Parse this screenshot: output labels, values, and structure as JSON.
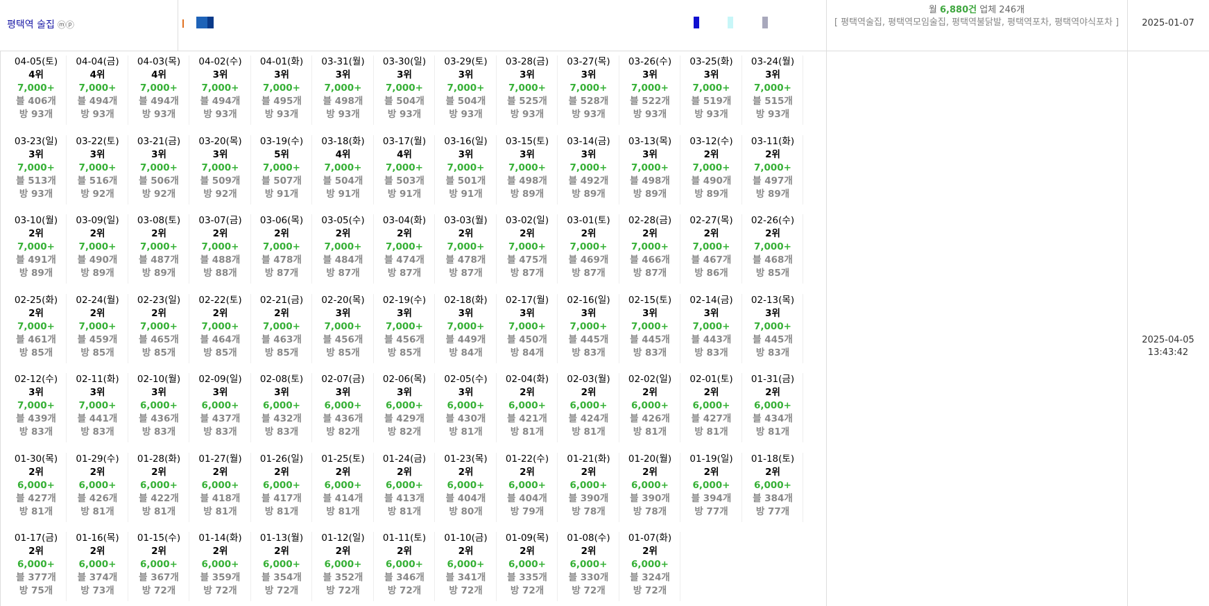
{
  "header": {
    "keyword": "평택역 술집",
    "keyword_symbols": "ⓜⓟ",
    "summary_prefix": "월",
    "monthly_count": "6,880건",
    "business_count": "업체 246개",
    "related_keywords": "[ 평택역술집, 평택역모임술집, 평택역불닭발, 평택역포차, 평택역야식포차 ]",
    "start_date": "2025-01-07"
  },
  "side": {
    "updated_date": "2025-04-05",
    "updated_time": "13:43:42"
  },
  "colors": {
    "green": "#36b036",
    "keyword_blue": "#1a1aa6",
    "gray": "#888888"
  },
  "days": [
    {
      "date": "04-05(토)",
      "rank": "4위",
      "volume": "7,000+",
      "blog": "블 406개",
      "cafe": "방 93개"
    },
    {
      "date": "04-04(금)",
      "rank": "4위",
      "volume": "7,000+",
      "blog": "블 494개",
      "cafe": "방 93개"
    },
    {
      "date": "04-03(목)",
      "rank": "4위",
      "volume": "7,000+",
      "blog": "블 494개",
      "cafe": "방 93개"
    },
    {
      "date": "04-02(수)",
      "rank": "3위",
      "volume": "7,000+",
      "blog": "블 494개",
      "cafe": "방 93개"
    },
    {
      "date": "04-01(화)",
      "rank": "3위",
      "volume": "7,000+",
      "blog": "블 495개",
      "cafe": "방 93개"
    },
    {
      "date": "03-31(월)",
      "rank": "3위",
      "volume": "7,000+",
      "blog": "블 498개",
      "cafe": "방 93개"
    },
    {
      "date": "03-30(일)",
      "rank": "3위",
      "volume": "7,000+",
      "blog": "블 504개",
      "cafe": "방 93개"
    },
    {
      "date": "03-29(토)",
      "rank": "3위",
      "volume": "7,000+",
      "blog": "블 504개",
      "cafe": "방 93개"
    },
    {
      "date": "03-28(금)",
      "rank": "3위",
      "volume": "7,000+",
      "blog": "블 525개",
      "cafe": "방 93개"
    },
    {
      "date": "03-27(목)",
      "rank": "3위",
      "volume": "7,000+",
      "blog": "블 528개",
      "cafe": "방 93개"
    },
    {
      "date": "03-26(수)",
      "rank": "3위",
      "volume": "7,000+",
      "blog": "블 522개",
      "cafe": "방 93개"
    },
    {
      "date": "03-25(화)",
      "rank": "3위",
      "volume": "7,000+",
      "blog": "블 519개",
      "cafe": "방 93개"
    },
    {
      "date": "03-24(월)",
      "rank": "3위",
      "volume": "7,000+",
      "blog": "블 515개",
      "cafe": "방 93개"
    },
    {
      "date": "03-23(일)",
      "rank": "3위",
      "volume": "7,000+",
      "blog": "블 513개",
      "cafe": "방 93개"
    },
    {
      "date": "03-22(토)",
      "rank": "3위",
      "volume": "7,000+",
      "blog": "블 516개",
      "cafe": "방 92개"
    },
    {
      "date": "03-21(금)",
      "rank": "3위",
      "volume": "7,000+",
      "blog": "블 506개",
      "cafe": "방 92개"
    },
    {
      "date": "03-20(목)",
      "rank": "3위",
      "volume": "7,000+",
      "blog": "블 509개",
      "cafe": "방 92개"
    },
    {
      "date": "03-19(수)",
      "rank": "5위",
      "volume": "7,000+",
      "blog": "블 507개",
      "cafe": "방 91개"
    },
    {
      "date": "03-18(화)",
      "rank": "4위",
      "volume": "7,000+",
      "blog": "블 504개",
      "cafe": "방 91개"
    },
    {
      "date": "03-17(월)",
      "rank": "4위",
      "volume": "7,000+",
      "blog": "블 503개",
      "cafe": "방 91개"
    },
    {
      "date": "03-16(일)",
      "rank": "3위",
      "volume": "7,000+",
      "blog": "블 501개",
      "cafe": "방 91개"
    },
    {
      "date": "03-15(토)",
      "rank": "3위",
      "volume": "7,000+",
      "blog": "블 498개",
      "cafe": "방 89개"
    },
    {
      "date": "03-14(금)",
      "rank": "3위",
      "volume": "7,000+",
      "blog": "블 492개",
      "cafe": "방 89개"
    },
    {
      "date": "03-13(목)",
      "rank": "3위",
      "volume": "7,000+",
      "blog": "블 498개",
      "cafe": "방 89개"
    },
    {
      "date": "03-12(수)",
      "rank": "2위",
      "volume": "7,000+",
      "blog": "블 490개",
      "cafe": "방 89개"
    },
    {
      "date": "03-11(화)",
      "rank": "2위",
      "volume": "7,000+",
      "blog": "블 497개",
      "cafe": "방 89개"
    },
    {
      "date": "03-10(월)",
      "rank": "2위",
      "volume": "7,000+",
      "blog": "블 491개",
      "cafe": "방 89개"
    },
    {
      "date": "03-09(일)",
      "rank": "2위",
      "volume": "7,000+",
      "blog": "블 490개",
      "cafe": "방 89개"
    },
    {
      "date": "03-08(토)",
      "rank": "2위",
      "volume": "7,000+",
      "blog": "블 487개",
      "cafe": "방 89개"
    },
    {
      "date": "03-07(금)",
      "rank": "2위",
      "volume": "7,000+",
      "blog": "블 488개",
      "cafe": "방 88개"
    },
    {
      "date": "03-06(목)",
      "rank": "2위",
      "volume": "7,000+",
      "blog": "블 478개",
      "cafe": "방 87개"
    },
    {
      "date": "03-05(수)",
      "rank": "2위",
      "volume": "7,000+",
      "blog": "블 484개",
      "cafe": "방 87개"
    },
    {
      "date": "03-04(화)",
      "rank": "2위",
      "volume": "7,000+",
      "blog": "블 474개",
      "cafe": "방 87개"
    },
    {
      "date": "03-03(월)",
      "rank": "2위",
      "volume": "7,000+",
      "blog": "블 478개",
      "cafe": "방 87개"
    },
    {
      "date": "03-02(일)",
      "rank": "2위",
      "volume": "7,000+",
      "blog": "블 475개",
      "cafe": "방 87개"
    },
    {
      "date": "03-01(토)",
      "rank": "2위",
      "volume": "7,000+",
      "blog": "블 469개",
      "cafe": "방 87개"
    },
    {
      "date": "02-28(금)",
      "rank": "2위",
      "volume": "7,000+",
      "blog": "블 466개",
      "cafe": "방 87개"
    },
    {
      "date": "02-27(목)",
      "rank": "2위",
      "volume": "7,000+",
      "blog": "블 467개",
      "cafe": "방 86개"
    },
    {
      "date": "02-26(수)",
      "rank": "2위",
      "volume": "7,000+",
      "blog": "블 468개",
      "cafe": "방 85개"
    },
    {
      "date": "02-25(화)",
      "rank": "2위",
      "volume": "7,000+",
      "blog": "블 461개",
      "cafe": "방 85개"
    },
    {
      "date": "02-24(월)",
      "rank": "2위",
      "volume": "7,000+",
      "blog": "블 459개",
      "cafe": "방 85개"
    },
    {
      "date": "02-23(일)",
      "rank": "2위",
      "volume": "7,000+",
      "blog": "블 465개",
      "cafe": "방 85개"
    },
    {
      "date": "02-22(토)",
      "rank": "2위",
      "volume": "7,000+",
      "blog": "블 464개",
      "cafe": "방 85개"
    },
    {
      "date": "02-21(금)",
      "rank": "2위",
      "volume": "7,000+",
      "blog": "블 463개",
      "cafe": "방 85개"
    },
    {
      "date": "02-20(목)",
      "rank": "3위",
      "volume": "7,000+",
      "blog": "블 456개",
      "cafe": "방 85개"
    },
    {
      "date": "02-19(수)",
      "rank": "3위",
      "volume": "7,000+",
      "blog": "블 456개",
      "cafe": "방 85개"
    },
    {
      "date": "02-18(화)",
      "rank": "3위",
      "volume": "7,000+",
      "blog": "블 449개",
      "cafe": "방 84개"
    },
    {
      "date": "02-17(월)",
      "rank": "3위",
      "volume": "7,000+",
      "blog": "블 450개",
      "cafe": "방 84개"
    },
    {
      "date": "02-16(일)",
      "rank": "3위",
      "volume": "7,000+",
      "blog": "블 445개",
      "cafe": "방 83개"
    },
    {
      "date": "02-15(토)",
      "rank": "3위",
      "volume": "7,000+",
      "blog": "블 445개",
      "cafe": "방 83개"
    },
    {
      "date": "02-14(금)",
      "rank": "3위",
      "volume": "7,000+",
      "blog": "블 443개",
      "cafe": "방 83개"
    },
    {
      "date": "02-13(목)",
      "rank": "3위",
      "volume": "7,000+",
      "blog": "블 445개",
      "cafe": "방 83개"
    },
    {
      "date": "02-12(수)",
      "rank": "3위",
      "volume": "7,000+",
      "blog": "블 439개",
      "cafe": "방 83개"
    },
    {
      "date": "02-11(화)",
      "rank": "3위",
      "volume": "7,000+",
      "blog": "블 441개",
      "cafe": "방 83개"
    },
    {
      "date": "02-10(월)",
      "rank": "3위",
      "volume": "6,000+",
      "blog": "블 436개",
      "cafe": "방 83개"
    },
    {
      "date": "02-09(일)",
      "rank": "3위",
      "volume": "6,000+",
      "blog": "블 437개",
      "cafe": "방 83개"
    },
    {
      "date": "02-08(토)",
      "rank": "3위",
      "volume": "6,000+",
      "blog": "블 432개",
      "cafe": "방 83개"
    },
    {
      "date": "02-07(금)",
      "rank": "3위",
      "volume": "6,000+",
      "blog": "블 436개",
      "cafe": "방 82개"
    },
    {
      "date": "02-06(목)",
      "rank": "3위",
      "volume": "6,000+",
      "blog": "블 429개",
      "cafe": "방 82개"
    },
    {
      "date": "02-05(수)",
      "rank": "3위",
      "volume": "6,000+",
      "blog": "블 430개",
      "cafe": "방 81개"
    },
    {
      "date": "02-04(화)",
      "rank": "2위",
      "volume": "6,000+",
      "blog": "블 421개",
      "cafe": "방 81개"
    },
    {
      "date": "02-03(월)",
      "rank": "2위",
      "volume": "6,000+",
      "blog": "블 424개",
      "cafe": "방 81개"
    },
    {
      "date": "02-02(일)",
      "rank": "2위",
      "volume": "6,000+",
      "blog": "블 426개",
      "cafe": "방 81개"
    },
    {
      "date": "02-01(토)",
      "rank": "2위",
      "volume": "6,000+",
      "blog": "블 427개",
      "cafe": "방 81개"
    },
    {
      "date": "01-31(금)",
      "rank": "2위",
      "volume": "6,000+",
      "blog": "블 434개",
      "cafe": "방 81개"
    },
    {
      "date": "01-30(목)",
      "rank": "2위",
      "volume": "6,000+",
      "blog": "블 427개",
      "cafe": "방 81개"
    },
    {
      "date": "01-29(수)",
      "rank": "2위",
      "volume": "6,000+",
      "blog": "블 426개",
      "cafe": "방 81개"
    },
    {
      "date": "01-28(화)",
      "rank": "2위",
      "volume": "6,000+",
      "blog": "블 422개",
      "cafe": "방 81개"
    },
    {
      "date": "01-27(월)",
      "rank": "2위",
      "volume": "6,000+",
      "blog": "블 418개",
      "cafe": "방 81개"
    },
    {
      "date": "01-26(일)",
      "rank": "2위",
      "volume": "6,000+",
      "blog": "블 417개",
      "cafe": "방 81개"
    },
    {
      "date": "01-25(토)",
      "rank": "2위",
      "volume": "6,000+",
      "blog": "블 414개",
      "cafe": "방 81개"
    },
    {
      "date": "01-24(금)",
      "rank": "2위",
      "volume": "6,000+",
      "blog": "블 413개",
      "cafe": "방 81개"
    },
    {
      "date": "01-23(목)",
      "rank": "2위",
      "volume": "6,000+",
      "blog": "블 404개",
      "cafe": "방 80개"
    },
    {
      "date": "01-22(수)",
      "rank": "2위",
      "volume": "6,000+",
      "blog": "블 404개",
      "cafe": "방 79개"
    },
    {
      "date": "01-21(화)",
      "rank": "2위",
      "volume": "6,000+",
      "blog": "블 390개",
      "cafe": "방 78개"
    },
    {
      "date": "01-20(월)",
      "rank": "2위",
      "volume": "6,000+",
      "blog": "블 390개",
      "cafe": "방 78개"
    },
    {
      "date": "01-19(일)",
      "rank": "2위",
      "volume": "6,000+",
      "blog": "블 394개",
      "cafe": "방 77개"
    },
    {
      "date": "01-18(토)",
      "rank": "2위",
      "volume": "6,000+",
      "blog": "블 384개",
      "cafe": "방 77개"
    },
    {
      "date": "01-17(금)",
      "rank": "2위",
      "volume": "6,000+",
      "blog": "블 377개",
      "cafe": "방 75개"
    },
    {
      "date": "01-16(목)",
      "rank": "2위",
      "volume": "6,000+",
      "blog": "블 374개",
      "cafe": "방 73개"
    },
    {
      "date": "01-15(수)",
      "rank": "2위",
      "volume": "6,000+",
      "blog": "블 367개",
      "cafe": "방 72개"
    },
    {
      "date": "01-14(화)",
      "rank": "2위",
      "volume": "6,000+",
      "blog": "블 359개",
      "cafe": "방 72개"
    },
    {
      "date": "01-13(월)",
      "rank": "2위",
      "volume": "6,000+",
      "blog": "블 354개",
      "cafe": "방 72개"
    },
    {
      "date": "01-12(일)",
      "rank": "2위",
      "volume": "6,000+",
      "blog": "블 352개",
      "cafe": "방 72개"
    },
    {
      "date": "01-11(토)",
      "rank": "2위",
      "volume": "6,000+",
      "blog": "블 346개",
      "cafe": "방 72개"
    },
    {
      "date": "01-10(금)",
      "rank": "2위",
      "volume": "6,000+",
      "blog": "블 341개",
      "cafe": "방 72개"
    },
    {
      "date": "01-09(목)",
      "rank": "2위",
      "volume": "6,000+",
      "blog": "블 335개",
      "cafe": "방 72개"
    },
    {
      "date": "01-08(수)",
      "rank": "2위",
      "volume": "6,000+",
      "blog": "블 330개",
      "cafe": "방 72개"
    },
    {
      "date": "01-07(화)",
      "rank": "2위",
      "volume": "6,000+",
      "blog": "블 324개",
      "cafe": "방 72개"
    }
  ]
}
